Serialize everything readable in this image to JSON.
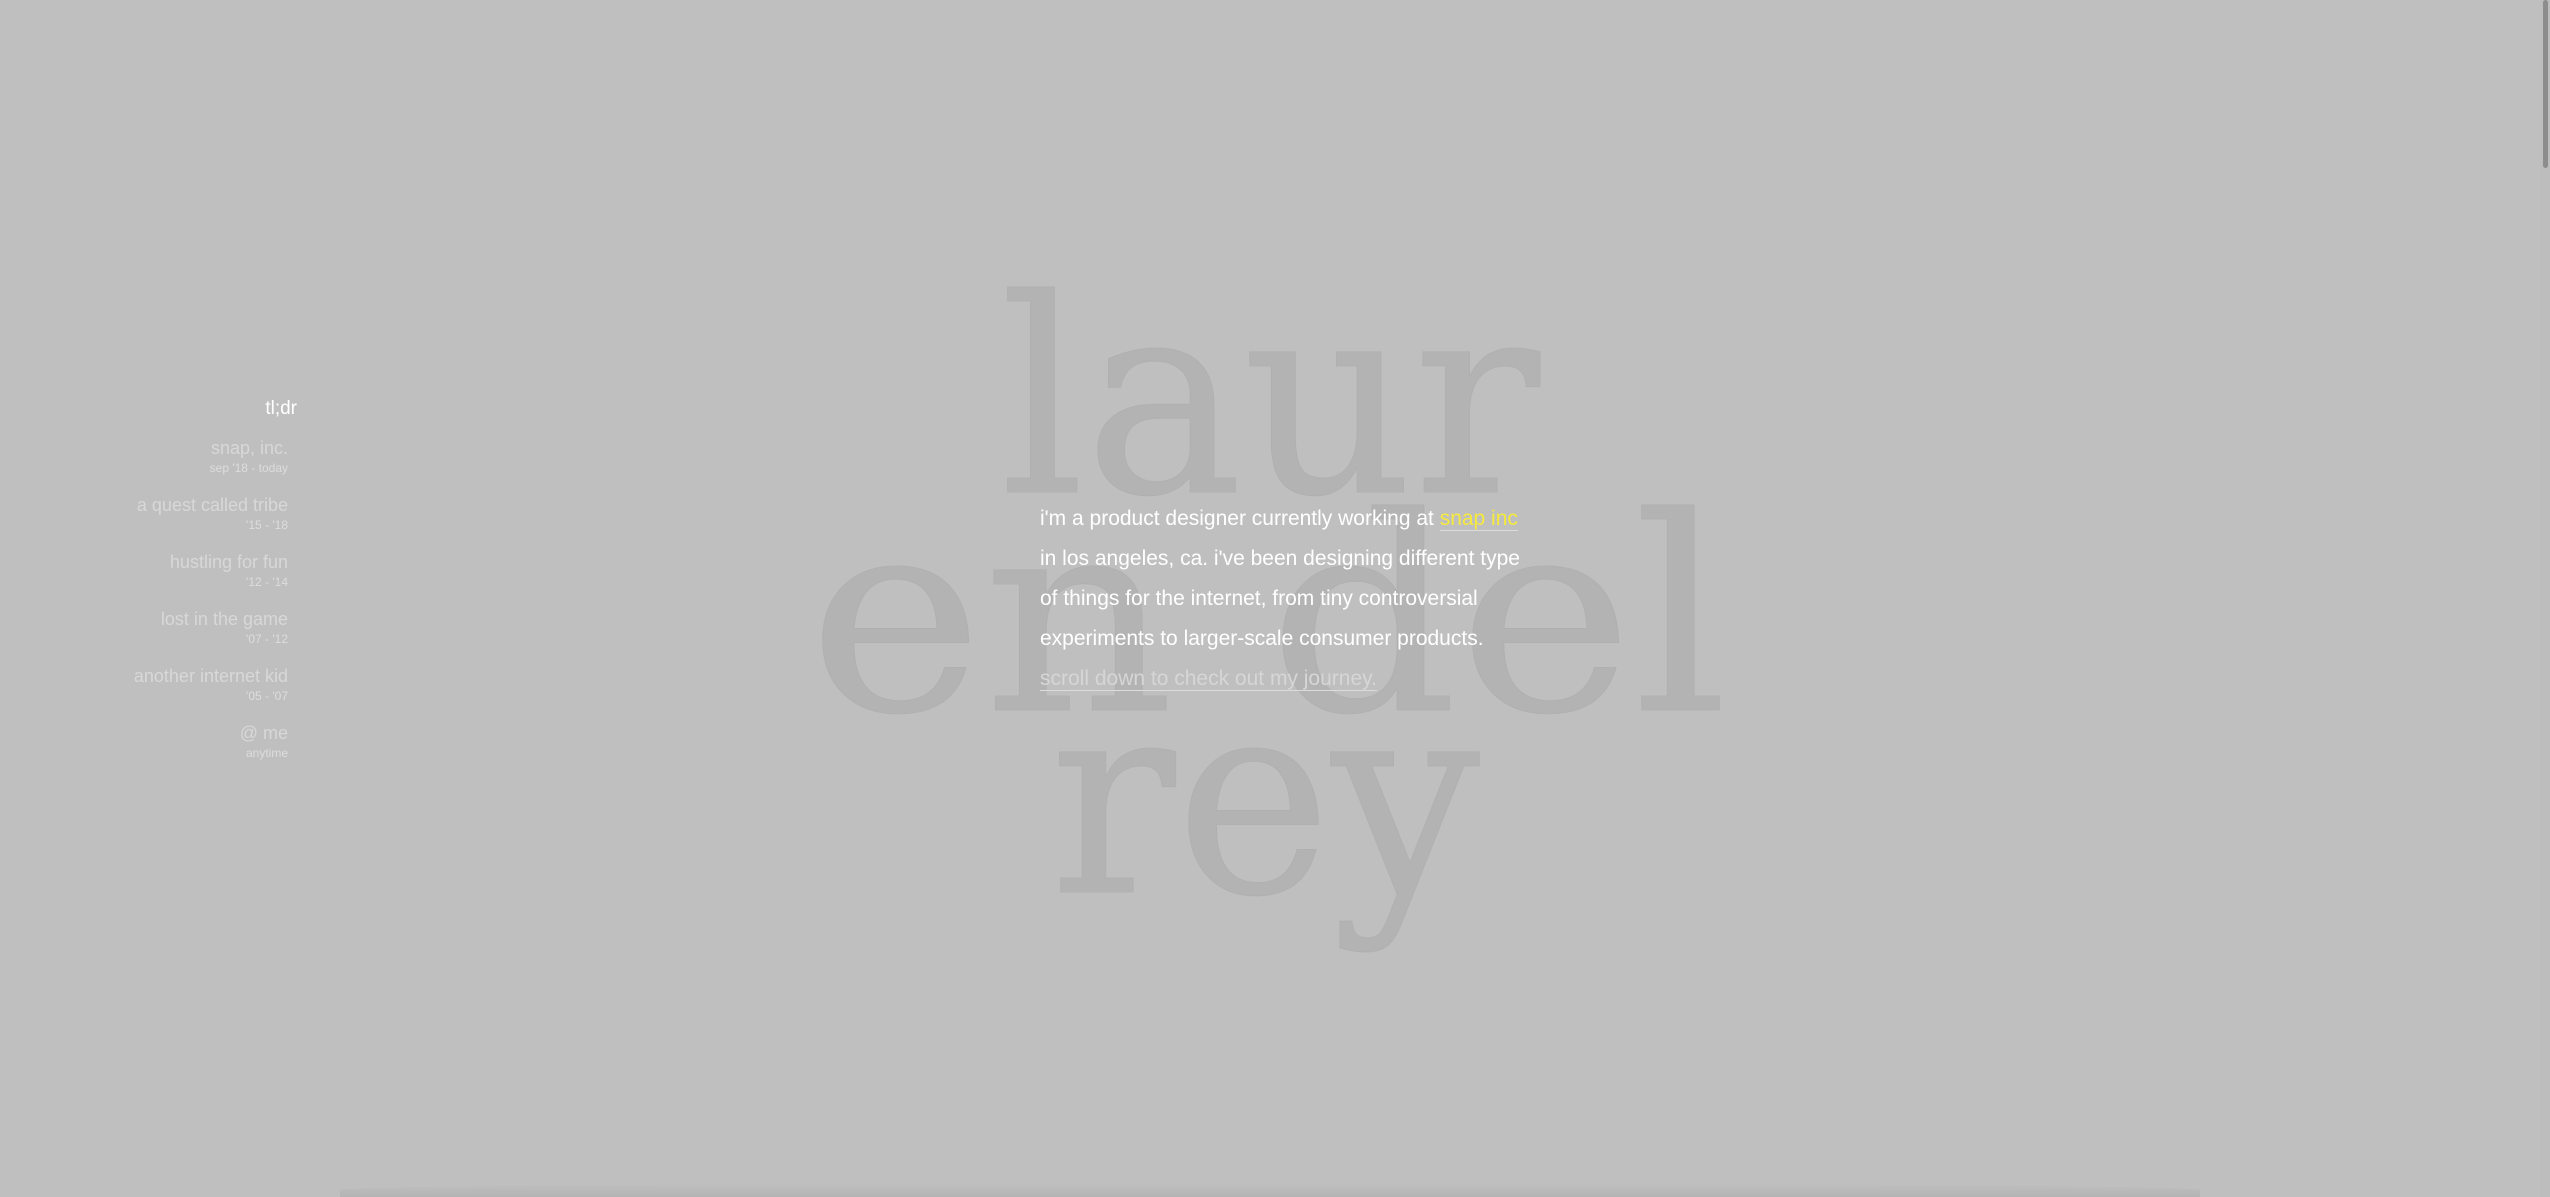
{
  "background_color": "#bfbfbf",
  "wordmark": {
    "line1": "laur",
    "line2": "en del",
    "line3": "rey"
  },
  "sidebar": {
    "title": "tl;dr",
    "items": [
      {
        "label": "snap, inc.",
        "date": "sep '18 - today"
      },
      {
        "label": "a quest called tribe",
        "date": "'15 - '18"
      },
      {
        "label": "hustling for fun",
        "date": "'12 - '14"
      },
      {
        "label": "lost in the game",
        "date": "'07 - '12"
      },
      {
        "label": "another internet kid",
        "date": "'05 - '07"
      },
      {
        "label": "@ me",
        "date": "anytime"
      }
    ]
  },
  "intro": {
    "text_before": "i'm a product designer currently working at ",
    "employer_link": "snap inc",
    "text_after": " in los angeles, ca. i've been designing different type of things for the internet, from tiny controversial experiments to larger-scale consumer products. ",
    "scroll_hint": "scroll down to check out my journey.",
    "highlight_color": "#f6ea3c"
  }
}
